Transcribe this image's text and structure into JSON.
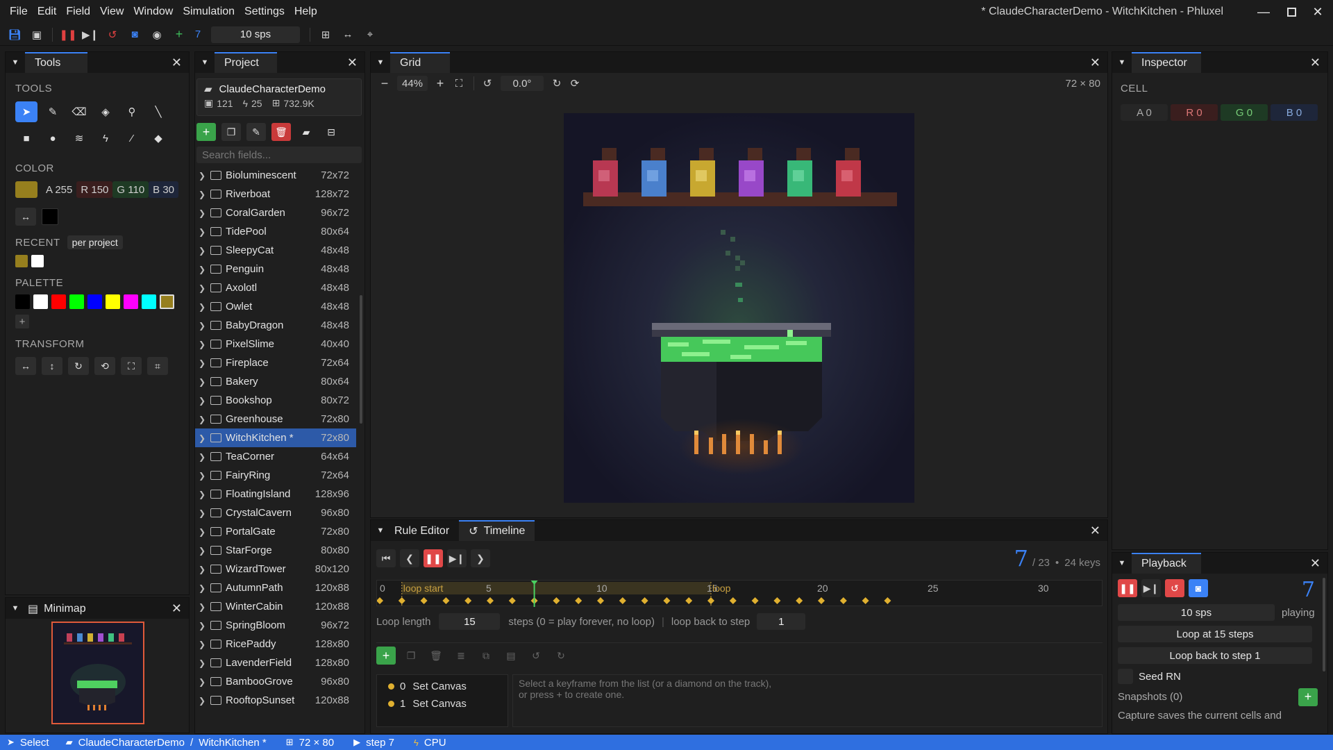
{
  "menubar": {
    "items": [
      "File",
      "Edit",
      "Field",
      "View",
      "Window",
      "Simulation",
      "Settings",
      "Help"
    ],
    "title": "* ClaudeCharacterDemo - WitchKitchen - Phluxel"
  },
  "toolbar": {
    "step": "7",
    "sps": "10 sps"
  },
  "tools": {
    "tab": "Tools",
    "heading_tools": "TOOLS",
    "heading_color": "COLOR",
    "color_a": "A 255",
    "color_r": "R 150",
    "color_g": "G 110",
    "color_b": "B 30",
    "current_color": "#967f1e",
    "recent_label": "RECENT",
    "recent_scope": "per project",
    "recent_colors": [
      "#967f1e",
      "#ffffff"
    ],
    "palette_label": "PALETTE",
    "palette": [
      "#000000",
      "#ffffff",
      "#ff0000",
      "#00ff00",
      "#0000ff",
      "#ffff00",
      "#ff00ff",
      "#00ffff",
      "#967f1e"
    ],
    "transform_label": "TRANSFORM"
  },
  "minimap": {
    "tab": "Minimap"
  },
  "project": {
    "tab": "Project",
    "name": "ClaudeCharacterDemo",
    "count_fields": "121",
    "count_rules": "25",
    "size": "732.9K",
    "search_placeholder": "Search fields...",
    "fields": [
      {
        "name": "Bioluminescent",
        "size": "72x72"
      },
      {
        "name": "Riverboat",
        "size": "128x72"
      },
      {
        "name": "CoralGarden",
        "size": "96x72"
      },
      {
        "name": "TidePool",
        "size": "80x64"
      },
      {
        "name": "SleepyCat",
        "size": "48x48"
      },
      {
        "name": "Penguin",
        "size": "48x48"
      },
      {
        "name": "Axolotl",
        "size": "48x48"
      },
      {
        "name": "Owlet",
        "size": "48x48"
      },
      {
        "name": "BabyDragon",
        "size": "48x48"
      },
      {
        "name": "PixelSlime",
        "size": "40x40"
      },
      {
        "name": "Fireplace",
        "size": "72x64"
      },
      {
        "name": "Bakery",
        "size": "80x64"
      },
      {
        "name": "Bookshop",
        "size": "80x72"
      },
      {
        "name": "Greenhouse",
        "size": "72x80"
      },
      {
        "name": "WitchKitchen  *",
        "size": "72x80"
      },
      {
        "name": "TeaCorner",
        "size": "64x64"
      },
      {
        "name": "FairyRing",
        "size": "72x64"
      },
      {
        "name": "FloatingIsland",
        "size": "128x96"
      },
      {
        "name": "CrystalCavern",
        "size": "96x80"
      },
      {
        "name": "PortalGate",
        "size": "72x80"
      },
      {
        "name": "StarForge",
        "size": "80x80"
      },
      {
        "name": "WizardTower",
        "size": "80x120"
      },
      {
        "name": "AutumnPath",
        "size": "120x88"
      },
      {
        "name": "WinterCabin",
        "size": "120x88"
      },
      {
        "name": "SpringBloom",
        "size": "96x72"
      },
      {
        "name": "RicePaddy",
        "size": "128x80"
      },
      {
        "name": "LavenderField",
        "size": "128x80"
      },
      {
        "name": "BambooGrove",
        "size": "96x80"
      },
      {
        "name": "RooftopSunset",
        "size": "120x88"
      }
    ]
  },
  "grid": {
    "tab": "Grid",
    "zoom": "44%",
    "rotation": "0.0°",
    "dims": "72 × 80"
  },
  "timeline": {
    "tab_rules": "Rule Editor",
    "tab_timeline": "Timeline",
    "step": "7",
    "total": "/ 23",
    "keys": "24 keys",
    "ticks": [
      {
        "v": 0,
        "label": "0"
      },
      {
        "v": 5,
        "label": "5"
      },
      {
        "v": 10,
        "label": "10"
      },
      {
        "v": 15,
        "label": "15"
      },
      {
        "v": 20,
        "label": "20"
      },
      {
        "v": 25,
        "label": "25"
      },
      {
        "v": 30,
        "label": "30"
      }
    ],
    "loop_start_label": "loop start",
    "loop_end_label": "loop",
    "loop_len_label": "Loop length",
    "loop_len": "15",
    "steps_hint": "steps  (0 = play forever, no loop)",
    "loop_back_label": "loop back to step",
    "loop_back": "1",
    "keyframes": [
      {
        "idx": "0",
        "label": "Set Canvas"
      },
      {
        "idx": "1",
        "label": "Set Canvas"
      }
    ],
    "hint1": "Select a keyframe from the list (or a diamond on the track),",
    "hint2": "or press + to create one."
  },
  "inspector": {
    "tab": "Inspector",
    "cell_label": "CELL",
    "a": "A 0",
    "r": "R 0",
    "g": "G 0",
    "b": "B 0"
  },
  "playback": {
    "tab": "Playback",
    "step": "7",
    "sps": "10 sps",
    "state": "playing",
    "loop_btn": "Loop at 15 steps",
    "loop_back_btn": "Loop back to step 1",
    "seed": "Seed RN",
    "snapshots": "Snapshots (0)",
    "capture": "Capture saves the current cells and"
  },
  "status": {
    "tool": "Select",
    "path1": "ClaudeCharacterDemo",
    "path_sep": "/",
    "path2": "WitchKitchen *",
    "dims": "72 × 80",
    "step": "step 7",
    "device": "CPU"
  }
}
